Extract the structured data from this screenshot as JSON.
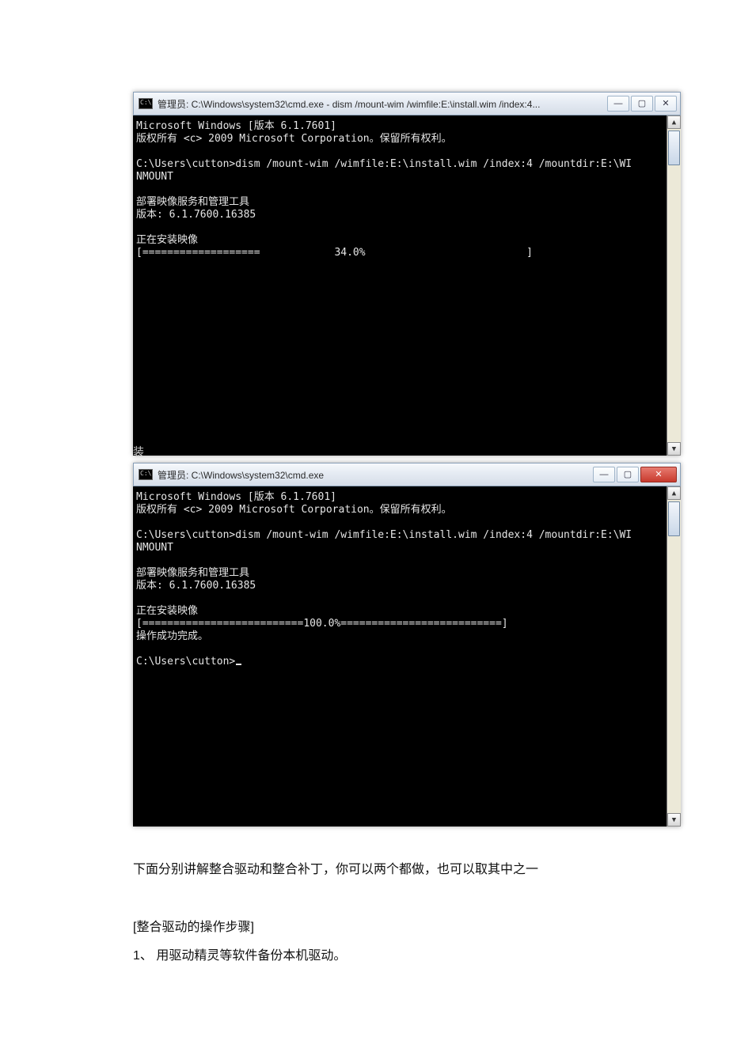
{
  "window1": {
    "title": "管理员: C:\\Windows\\system32\\cmd.exe - dism  /mount-wim /wimfile:E:\\install.wim /index:4...",
    "min": "—",
    "max": "▢",
    "close": "✕",
    "lines": {
      "l0": "Microsoft Windows [版本 6.1.7601]",
      "l1": "版权所有 <c> 2009 Microsoft Corporation。保留所有权利。",
      "l2": "",
      "l3": "C:\\Users\\cutton>dism /mount-wim /wimfile:E:\\install.wim /index:4 /mountdir:E:\\WI",
      "l4": "NMOUNT",
      "l5": "",
      "l6": "部署映像服务和管理工具",
      "l7": "版本: 6.1.7600.16385",
      "l8": "",
      "l9": "正在安装映像",
      "l10": "[===================            34.0%                          ]"
    }
  },
  "stray_char": "装",
  "window2": {
    "title": "管理员: C:\\Windows\\system32\\cmd.exe",
    "min": "—",
    "max": "▢",
    "close": "✕",
    "lines": {
      "l0": "Microsoft Windows [版本 6.1.7601]",
      "l1": "版权所有 <c> 2009 Microsoft Corporation。保留所有权利。",
      "l2": "",
      "l3": "C:\\Users\\cutton>dism /mount-wim /wimfile:E:\\install.wim /index:4 /mountdir:E:\\WI",
      "l4": "NMOUNT",
      "l5": "",
      "l6": "部署映像服务和管理工具",
      "l7": "版本: 6.1.7600.16385",
      "l8": "",
      "l9": "正在安装映像",
      "l10": "[==========================100.0%==========================]",
      "l11": "操作成功完成。",
      "l12": "",
      "l13": "C:\\Users\\cutton>"
    }
  },
  "doc": {
    "p1": "下面分别讲解整合驱动和整合补丁，你可以两个都做，也可以取其中之一",
    "p2": "[整合驱动的操作步骤]",
    "p3": "1、 用驱动精灵等软件备份本机驱动。"
  }
}
